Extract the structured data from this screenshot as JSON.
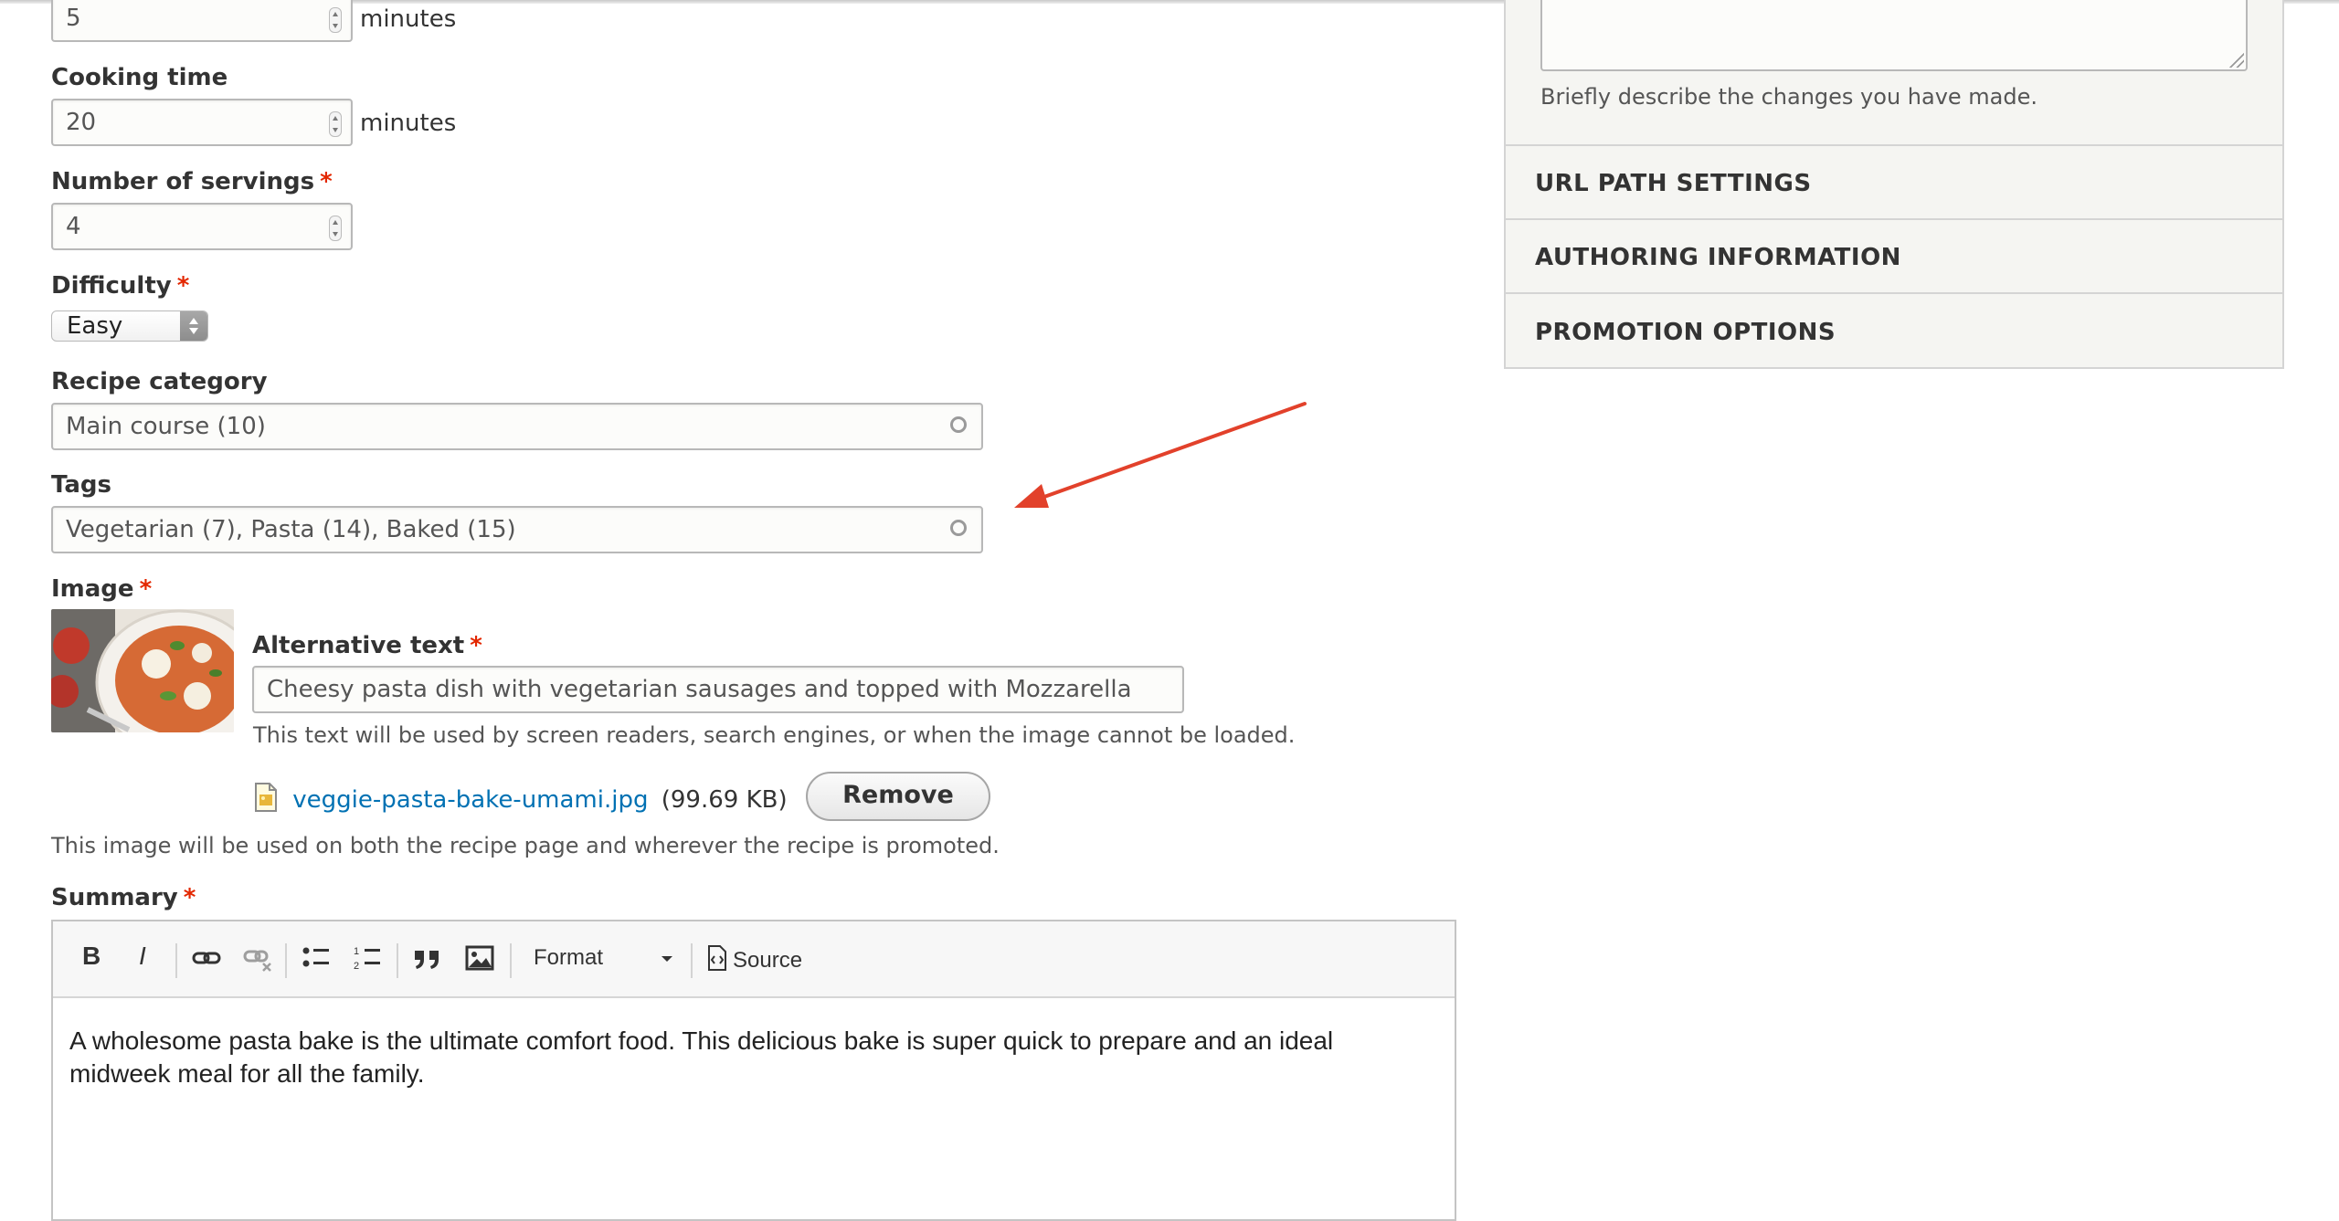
{
  "form": {
    "prep_time": {
      "value": "5",
      "unit": "minutes"
    },
    "cooking_time": {
      "label": "Cooking time",
      "value": "20",
      "unit": "minutes"
    },
    "servings": {
      "label": "Number of servings",
      "required": "*",
      "value": "4"
    },
    "difficulty": {
      "label": "Difficulty",
      "required": "*",
      "value": "Easy"
    },
    "recipe_category": {
      "label": "Recipe category",
      "value": "Main course (10)"
    },
    "tags": {
      "label": "Tags",
      "value": "Vegetarian (7), Pasta (14), Baked (15)"
    },
    "image": {
      "label": "Image",
      "required": "*",
      "alt_label": "Alternative text",
      "alt_required": "*",
      "alt_value": "Cheesy pasta dish with vegetarian sausages and topped with Mozzarella",
      "alt_description": "This text will be used by screen readers, search engines, or when the image cannot be loaded.",
      "file_name": "veggie-pasta-bake-umami.jpg",
      "file_size": "(99.69 KB)",
      "remove_label": "Remove",
      "description": "This image will be used on both the recipe page and wherever the recipe is promoted."
    },
    "summary": {
      "label": "Summary",
      "required": "*",
      "toolbar": {
        "bold": "B",
        "italic": "I",
        "format_label": "Format",
        "source_label": "Source"
      },
      "body": "A wholesome pasta bake is the ultimate comfort food. This delicious bake is super quick to prepare and an ideal midweek meal for all the family."
    }
  },
  "sidebar": {
    "revision_help": "Briefly describe the changes you have made.",
    "sections": [
      {
        "title": "URL PATH SETTINGS"
      },
      {
        "title": "AUTHORING INFORMATION"
      },
      {
        "title": "PROMOTION OPTIONS"
      }
    ]
  },
  "colors": {
    "required": "#e32700",
    "link": "#0071b3",
    "annotation_arrow": "#e2412b"
  },
  "icons": [
    "spinner-icon",
    "select-arrows-icon",
    "autocomplete-throbber-icon",
    "file-image-icon",
    "bold-icon",
    "italic-icon",
    "link-icon",
    "unlink-icon",
    "bulleted-list-icon",
    "numbered-list-icon",
    "blockquote-icon",
    "image-icon",
    "dropdown-caret-icon",
    "source-icon",
    "resize-grip-icon",
    "annotation-arrow-icon"
  ]
}
